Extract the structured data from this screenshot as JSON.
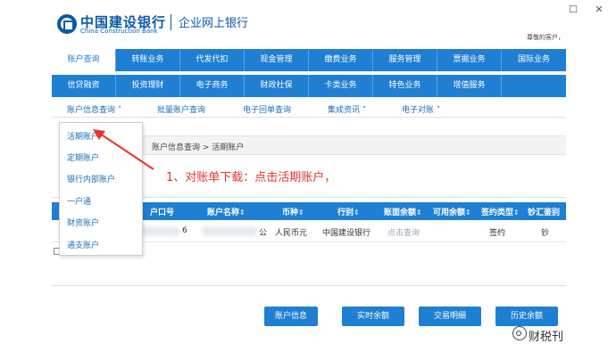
{
  "window": {
    "minimize": "—",
    "maximize": "☐",
    "close": "✕"
  },
  "bank": {
    "name_cn": "中国建设银行",
    "name_en": "China Construction Bank",
    "subtitle": "企业网上银行",
    "welcome": "尊敬的客户，"
  },
  "nav_row1": [
    "账户查询",
    "转账业务",
    "代发代扣",
    "现金管理",
    "缴费业务",
    "服务管理",
    "票据业务",
    "国际业务"
  ],
  "nav_row2": [
    "信贷融资",
    "投资理财",
    "电子商务",
    "财政社保",
    "卡类业务",
    "特色业务",
    "增值服务",
    ""
  ],
  "subnav": [
    "账户信息查询 ˄",
    "批量账户查询",
    "电子回单查询",
    "集成资讯 ˅",
    "电子对账 ˅"
  ],
  "dropdown": [
    "活期账户",
    "定期账户",
    "银行内部账户",
    "一户通",
    "财资账户",
    "通支账户"
  ],
  "breadcrumb": "账户信息查询 > 活期账户",
  "annotation": "1、对账单下载：点击活期账户，",
  "table": {
    "columns": [
      {
        "label": "户口号",
        "sort": ""
      },
      {
        "label": "账户名称",
        "sort": "⇕"
      },
      {
        "label": "币种",
        "sort": "⇕"
      },
      {
        "label": "行别",
        "sort": "⇕"
      },
      {
        "label": "账面余额",
        "sort": "⇕"
      },
      {
        "label": "可用余额",
        "sort": "⇕"
      },
      {
        "label": "签约类型",
        "sort": "⇕"
      },
      {
        "label": "钞汇鉴别",
        "sort": ""
      }
    ],
    "row": {
      "account_suffix": "6",
      "name_fragment": "公",
      "currency": "人民币元",
      "bank": "中国建设银行",
      "balance": "点击查询",
      "sign_type": "签约",
      "cash": "钞"
    }
  },
  "actions": [
    "账户信息",
    "实时余额",
    "交易明细",
    "历史余额"
  ],
  "watermark": "财税刊",
  "colors": {
    "primary": "#1e7fd3",
    "annotation": "#e8342c",
    "link": "#1e6db8"
  }
}
